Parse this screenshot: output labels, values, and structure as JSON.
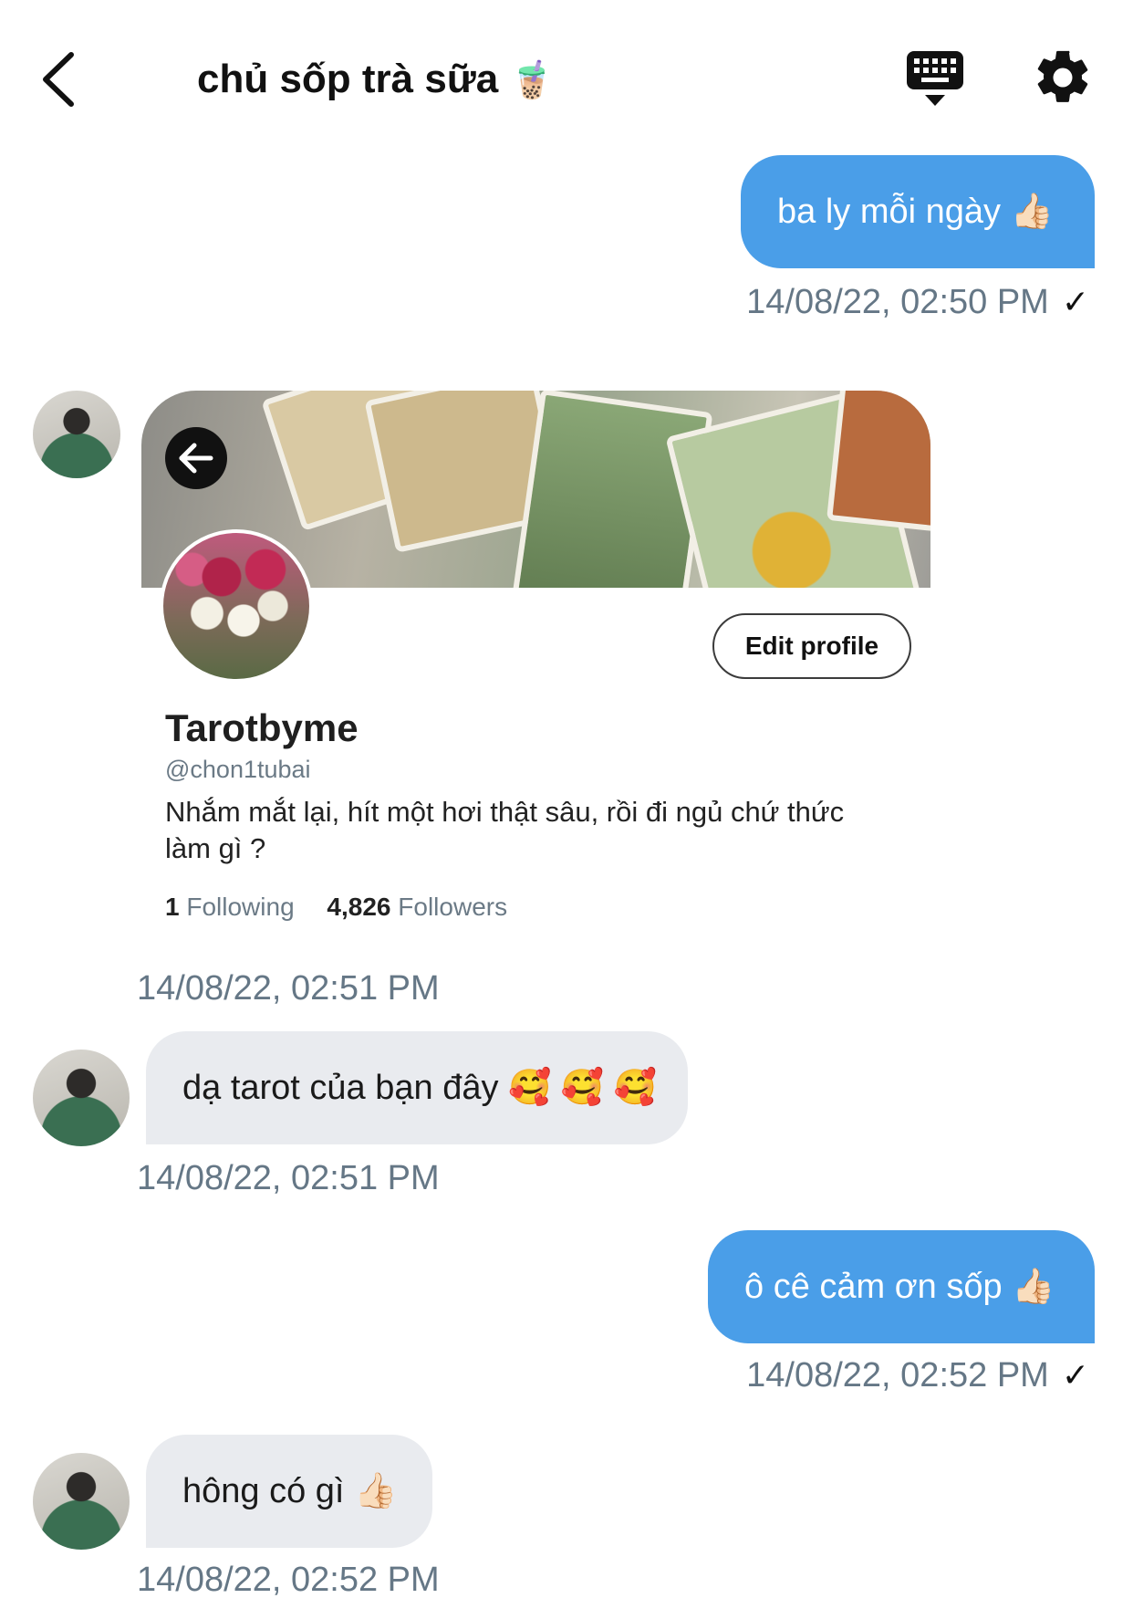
{
  "header": {
    "title": "chủ sốp trà sữa",
    "title_emoji": "🧋"
  },
  "messages": [
    {
      "text": "ba ly mỗi ngày 👍🏻",
      "timestamp": "14/08/22, 02:50 PM",
      "check": "✓"
    },
    {
      "profile_card": {
        "name": "Tarotbyme",
        "handle": "@chon1tubai",
        "bio": "Nhắm mắt lại, hít một hơi thật sâu, rồi đi ngủ chứ thức làm gì ?",
        "edit_button": "Edit profile",
        "following_count": "1",
        "following_label": "Following",
        "followers_count": "4,826",
        "followers_label": "Followers"
      },
      "timestamp": "14/08/22, 02:51 PM"
    },
    {
      "text": "dạ tarot của bạn đây 🥰 🥰 🥰",
      "timestamp": "14/08/22, 02:51 PM"
    },
    {
      "text": "ô cê cảm ơn sốp 👍🏻",
      "timestamp": "14/08/22, 02:52 PM",
      "check": "✓"
    },
    {
      "text": "hông có gì 👍🏻",
      "timestamp": "14/08/22, 02:52 PM"
    }
  ],
  "colors": {
    "outgoing_bubble": "#4a9ee8",
    "incoming_bubble": "#e9ebef",
    "timestamp": "#657786"
  },
  "icons": [
    "back-chevron-icon",
    "keyboard-icon",
    "gear-icon",
    "banner-back-arrow-icon",
    "check-icon"
  ]
}
